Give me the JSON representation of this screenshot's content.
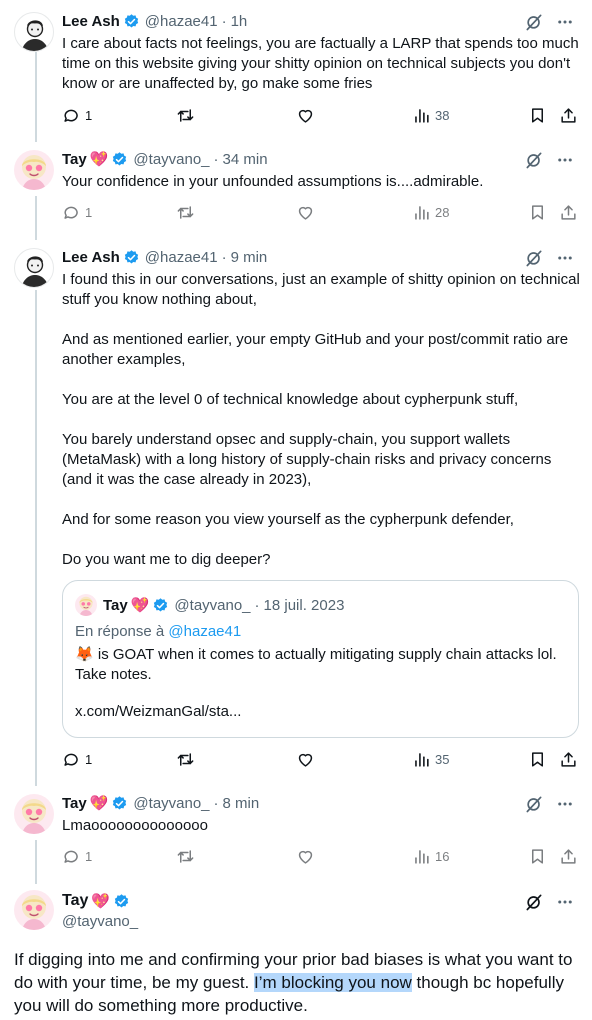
{
  "tweets": [
    {
      "name": "Lee Ash",
      "handle": "@hazae41",
      "time": "1h",
      "text": "I care about facts not feelings, you are factually a LARP that spends too much time on this website giving your shitty opinion on technical subjects you don't know or are unaffected by, go make some fries",
      "replies": "1",
      "views": "38"
    },
    {
      "name": "Tay",
      "handle": "@tayvano_",
      "time": "34 min",
      "text": "Your confidence in your unfounded assumptions is....admirable.",
      "replies": "1",
      "views": "28"
    },
    {
      "name": "Lee Ash",
      "handle": "@hazae41",
      "time": "9 min",
      "paragraphs": [
        "I found this in our conversations, just an example of shitty opinion on technical stuff you know nothing about,",
        "And as mentioned earlier, your empty GitHub and your post/commit ratio are another examples,",
        "You are at the level 0 of technical knowledge about cypherpunk stuff,",
        "You barely understand opsec and supply-chain, you support wallets (MetaMask) with a long history of supply-chain risks and privacy concerns (and it was the case already in 2023),",
        "And for some reason you view yourself as the cypherpunk defender,",
        "Do you want me to dig deeper?"
      ],
      "quote": {
        "name": "Tay",
        "handle": "@tayvano_",
        "date": "18 juil. 2023",
        "reply_prefix": "En réponse à ",
        "reply_to": "@hazae41",
        "emoji": "🦊",
        "text": " is GOAT when it comes to actually mitigating supply chain attacks lol. Take notes.",
        "link": "x.com/WeizmanGal/sta..."
      },
      "replies": "1",
      "views": "35"
    },
    {
      "name": "Tay",
      "handle": "@tayvano_",
      "time": "8 min",
      "text": "Lmaoooooooooooooo",
      "replies": "1",
      "views": "16"
    }
  ],
  "final": {
    "name": "Tay",
    "handle": "@tayvano_",
    "text_before": "If digging into me and confirming your prior bad biases is what you want to do with your time, be my guest. ",
    "text_highlight": "I’m blocking you now",
    "text_after": " though bc hopefully you will do something more productive."
  },
  "colors": {
    "text": "#0f1419",
    "secondary": "#536471",
    "accent": "#1d9bf0",
    "heart": "#e0245e",
    "highlight": "#b4d7fb",
    "border": "#cfd9de"
  },
  "icons": [
    "reply-icon",
    "retweet-icon",
    "like-icon",
    "views-icon",
    "bookmark-icon",
    "share-icon",
    "grok-icon",
    "more-icon",
    "verified-badge-icon"
  ]
}
